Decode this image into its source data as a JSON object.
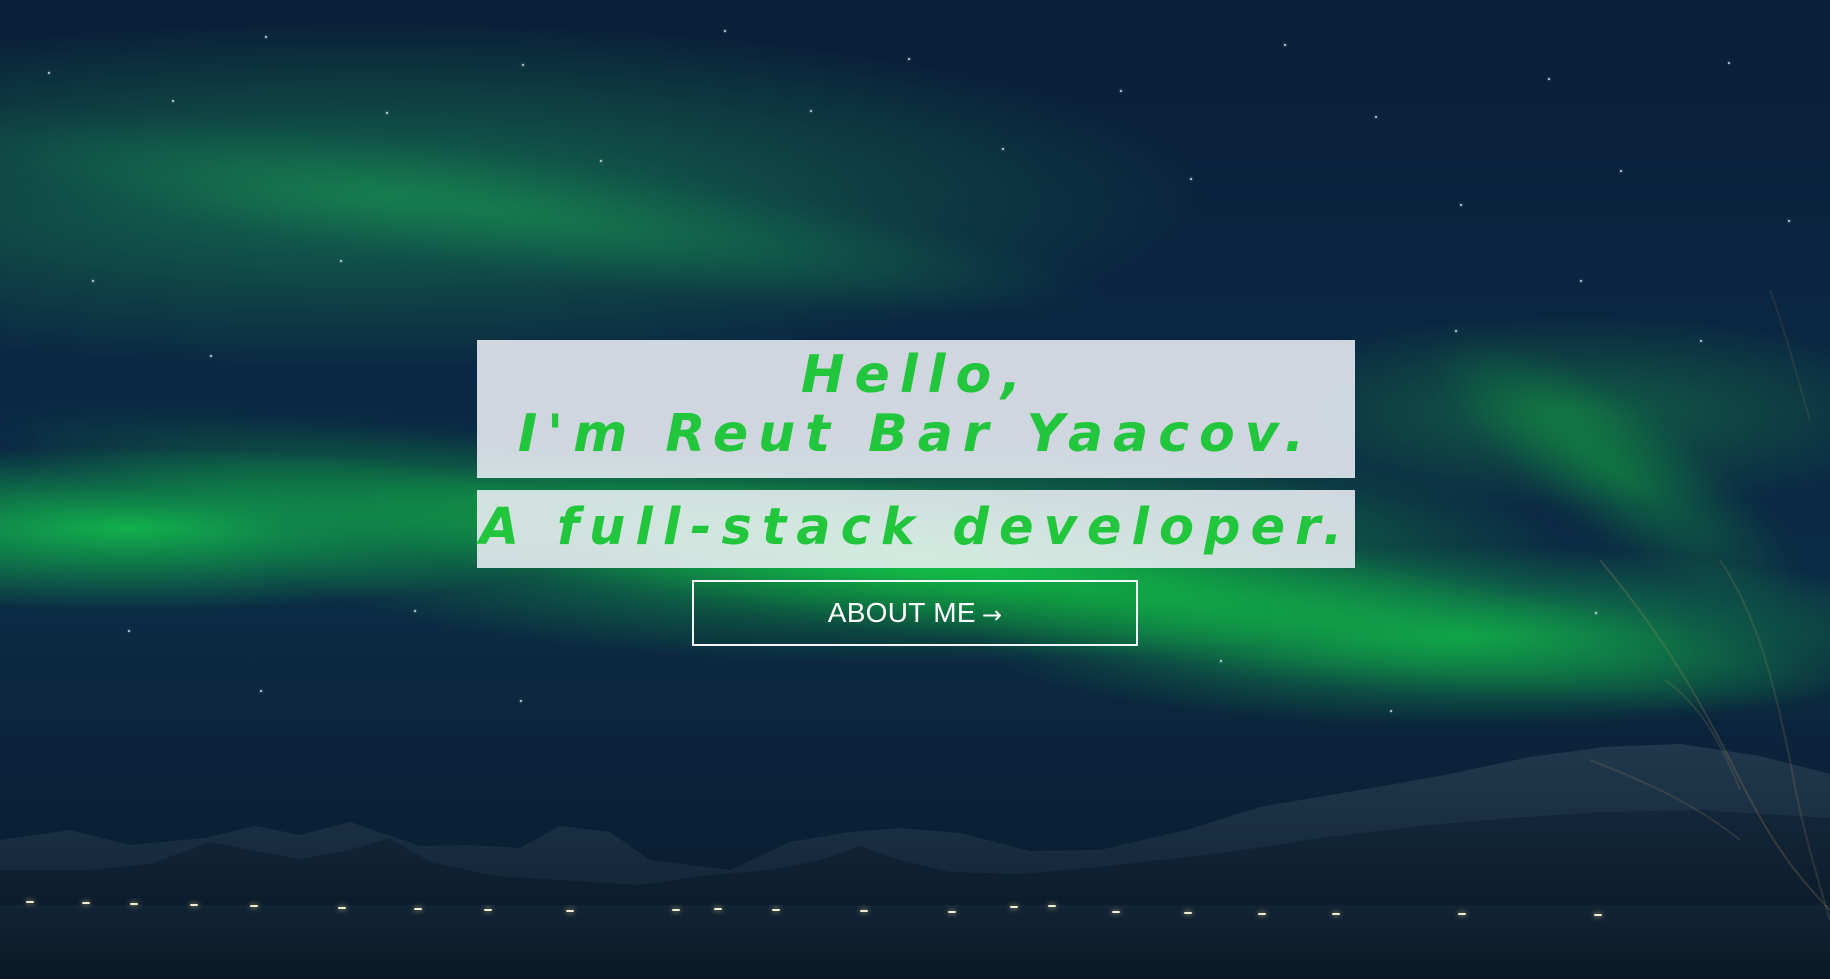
{
  "hero": {
    "greeting": "Hello,",
    "intro": "I'm Reut Bar Yaacov.",
    "role": "A full-stack developer."
  },
  "cta": {
    "label": "ABOUT ME",
    "icon": "arrow-right-icon",
    "icon_text": "→"
  },
  "colors": {
    "accent": "#22c63d",
    "panel": "#eceef5",
    "button_border": "#f4f6fa"
  }
}
